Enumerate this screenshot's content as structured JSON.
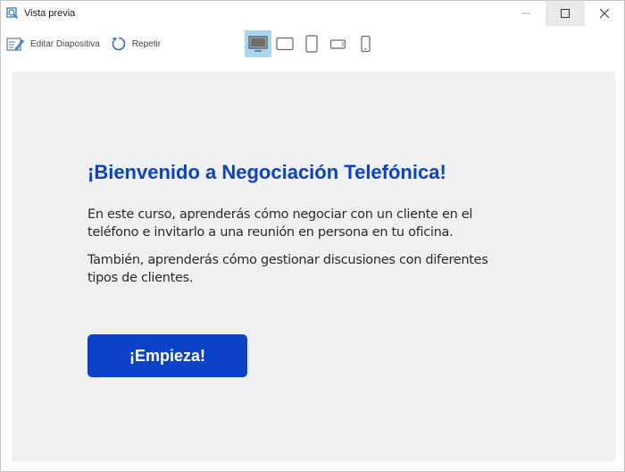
{
  "window": {
    "title": "Vista previa",
    "controls": [
      "minimize-icon",
      "maximize-icon",
      "close-icon"
    ]
  },
  "toolbar": {
    "edit_label": "Editar Diapositiva",
    "repeat_label": "Repetir",
    "devices": [
      "desktop-icon",
      "tablet-landscape-icon",
      "tablet-portrait-icon",
      "phone-landscape-icon",
      "phone-portrait-icon"
    ],
    "active_device": "desktop-icon"
  },
  "slide": {
    "heading": "¡Bienvenido a Negociación Telefónica!",
    "paragraph1": "En este curso, aprenderás cómo negociar con un cliente en el teléfono e invitarlo a una reunión en persona en tu oficina.",
    "paragraph2": "También, aprenderás cómo gestionar discusiones con diferentes tipos de clientes.",
    "button_label": "¡Empieza!"
  },
  "colors": {
    "accent": "#0b42c8",
    "slide_background": "#eff0f2",
    "active_device_bg": "#a9d6f0"
  }
}
